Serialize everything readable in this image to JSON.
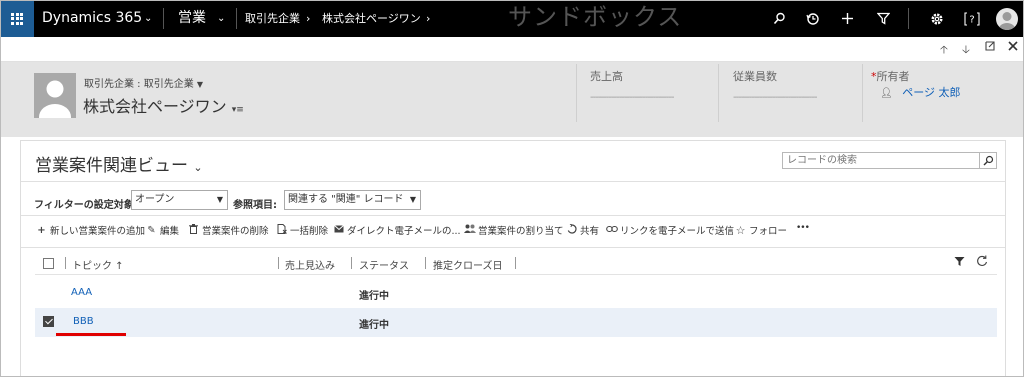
{
  "topbar": {
    "app_name": "Dynamics 365",
    "area": "営業",
    "breadcrumb": [
      "取引先企業",
      "株式会社ページワン"
    ],
    "environment_label": "サンドボックス",
    "icons": [
      "search-icon",
      "history-icon",
      "plus-icon",
      "filter-icon",
      "gear-icon",
      "help-icon",
      "user-avatar"
    ]
  },
  "subbar": {
    "icons": [
      "arrow-up-icon",
      "arrow-down-icon",
      "popout-icon",
      "close-icon"
    ]
  },
  "record_header": {
    "entity_label": "取引先企業 : 取引先企業",
    "name": "株式会社ページワン",
    "fields": [
      {
        "label": "売上高",
        "value": "--------------------------------"
      },
      {
        "label": "従業員数",
        "value": "--------------------------------"
      },
      {
        "label": "所有者",
        "required": true,
        "value": "ページ 太郎"
      }
    ]
  },
  "view": {
    "title": "営業案件関連ビュー",
    "search_placeholder": "レコードの検索",
    "filter_label": "フィルターの設定対象:",
    "filter_value": "オープン",
    "ref_label": "参照項目:",
    "ref_value": "関連する \"関連\" レコード",
    "commands": [
      {
        "icon": "plus-icon",
        "label": "新しい営業案件の追加"
      },
      {
        "icon": "pencil-icon",
        "label": "編集"
      },
      {
        "icon": "trash-icon",
        "label": "営業案件の削除"
      },
      {
        "icon": "bulk-delete-icon",
        "label": "一括削除"
      },
      {
        "icon": "email-icon",
        "label": "ダイレクト電子メールの..."
      },
      {
        "icon": "assign-icon",
        "label": "営業案件の割り当て"
      },
      {
        "icon": "share-icon",
        "label": "共有"
      },
      {
        "icon": "link-icon",
        "label": "リンクを電子メールで送信"
      },
      {
        "icon": "star-icon",
        "label": "フォロー"
      },
      {
        "icon": "more-icon",
        "label": "•••"
      }
    ],
    "columns": [
      "トピック ↑",
      "売上見込み",
      "ステータス",
      "推定クローズ日"
    ],
    "rows": [
      {
        "topic": "AAA",
        "revenue": "",
        "status": "進行中",
        "close_date": "",
        "checked": false
      },
      {
        "topic": "BBB",
        "revenue": "",
        "status": "進行中",
        "close_date": "",
        "checked": true
      }
    ]
  },
  "colors": {
    "topbar": "#000000",
    "waffle": "#1d5c94",
    "header_bg": "#e4e4e4",
    "link": "#1160b7",
    "highlight_underline": "#e00000"
  }
}
